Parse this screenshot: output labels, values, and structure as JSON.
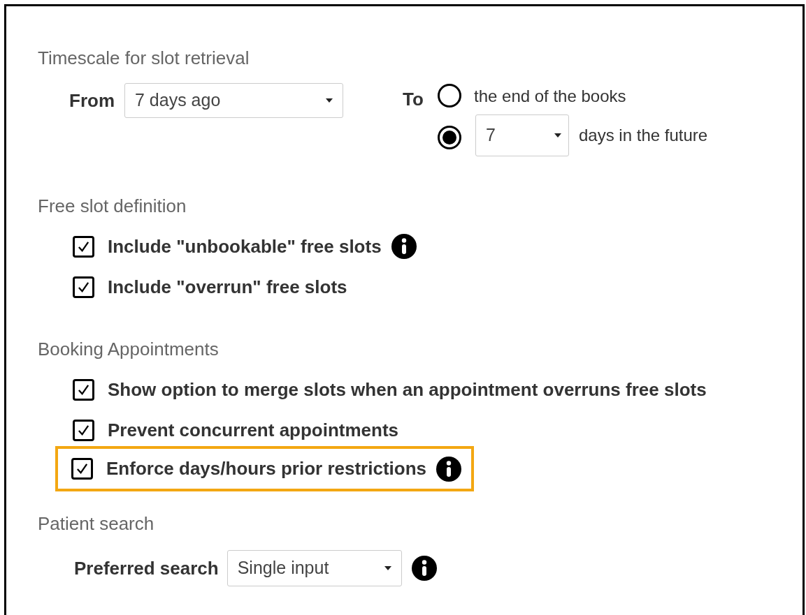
{
  "timescale": {
    "heading": "Timescale for slot retrieval",
    "from_label": "From",
    "from_value": "7 days ago",
    "to_label": "To",
    "to_options": [
      {
        "kind": "text",
        "label": "the end of the books",
        "selected": false
      },
      {
        "kind": "select",
        "value": "7",
        "suffix": "days in the future",
        "selected": true
      }
    ]
  },
  "free_slot_definition": {
    "heading": "Free slot definition",
    "options": [
      {
        "label": "Include \"unbookable\" free slots",
        "checked": true,
        "info": true,
        "highlighted": false
      },
      {
        "label": "Include \"overrun\" free slots",
        "checked": true,
        "info": false,
        "highlighted": false
      }
    ]
  },
  "booking_appointments": {
    "heading": "Booking Appointments",
    "options": [
      {
        "label": "Show option to merge slots when an appointment overruns free slots",
        "checked": true,
        "info": false,
        "highlighted": false
      },
      {
        "label": "Prevent concurrent appointments",
        "checked": true,
        "info": false,
        "highlighted": false
      },
      {
        "label": "Enforce days/hours prior restrictions",
        "checked": true,
        "info": true,
        "highlighted": true
      }
    ]
  },
  "patient_search": {
    "heading": "Patient search",
    "label": "Preferred search",
    "value": "Single input",
    "info": true
  }
}
